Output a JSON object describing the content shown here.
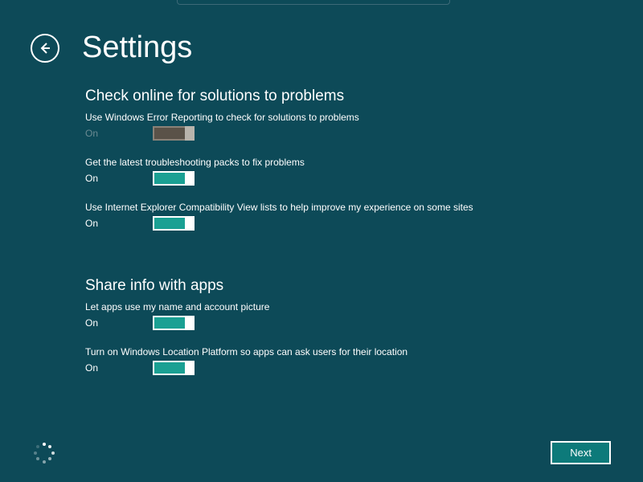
{
  "page_title": "Settings",
  "sections": [
    {
      "heading": "Check online for solutions to problems",
      "items": [
        {
          "desc": "Use Windows Error Reporting to check for solutions to problems",
          "state": "On",
          "enabled": false
        },
        {
          "desc": "Get the latest troubleshooting packs to fix problems",
          "state": "On",
          "enabled": true
        },
        {
          "desc": "Use Internet Explorer Compatibility View lists to help improve my experience on some sites",
          "state": "On",
          "enabled": true
        }
      ]
    },
    {
      "heading": "Share info with apps",
      "items": [
        {
          "desc": "Let apps use my name and account picture",
          "state": "On",
          "enabled": true
        },
        {
          "desc": "Turn on Windows Location Platform so apps can ask users for their location",
          "state": "On",
          "enabled": true
        }
      ]
    }
  ],
  "next_button": "Next"
}
